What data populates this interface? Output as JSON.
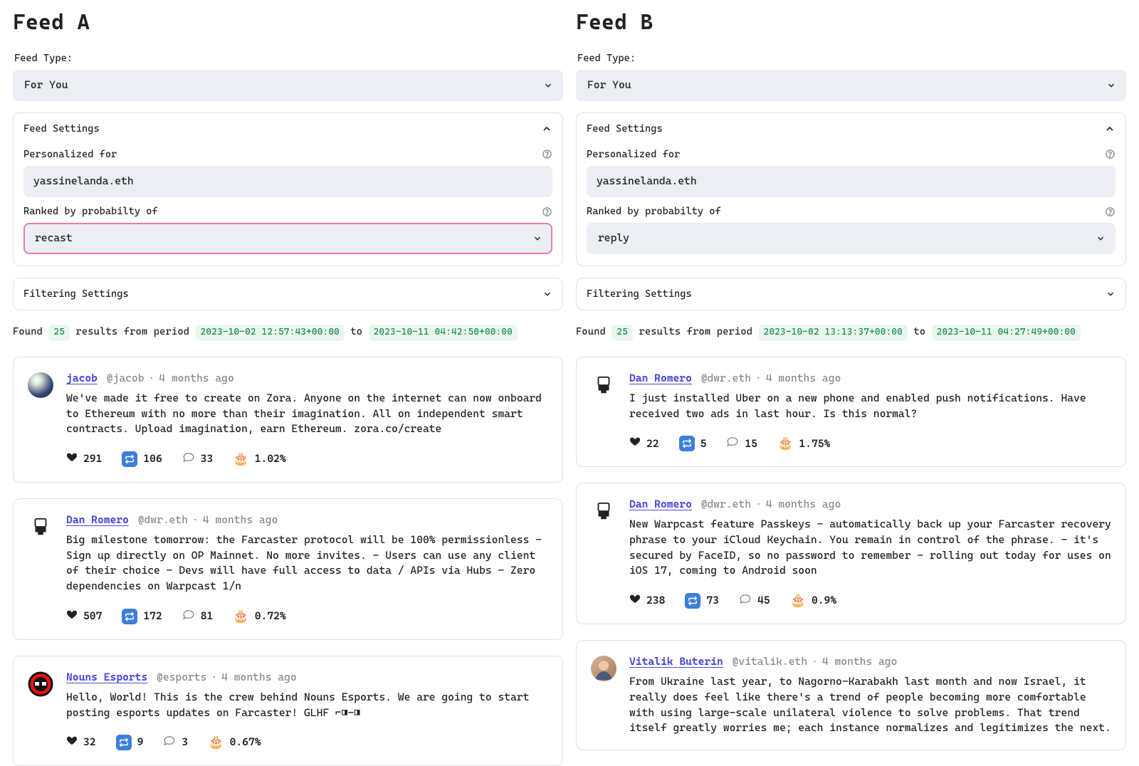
{
  "feeds": [
    {
      "title": "Feed A",
      "feed_type_label": "Feed Type:",
      "feed_type_value": "For You",
      "settings_header": "Feed Settings",
      "personalized_label": "Personalized for",
      "personalized_value": "yassinelanda.eth",
      "ranked_label": "Ranked by probabilty of",
      "ranked_value": "recast",
      "ranked_focused": true,
      "filtering_header": "Filtering Settings",
      "found_prefix": "Found",
      "found_count": "25",
      "found_mid": "results from period",
      "found_start": "2023-10-02 12:57:43+00:00",
      "found_to": "to",
      "found_end": "2023-10-11 04:42:50+00:00",
      "posts": [
        {
          "avatar_kind": "sphere",
          "author": "jacob",
          "handle": "@jacob",
          "time": "4 months ago",
          "content": "We've made it free to create on Zora. Anyone on the internet can now onboard to Ethereum with no more than their imagination. All on independent smart contracts. Upload imagination, earn Ethereum. zora.co/create",
          "likes": "291",
          "recasts": "106",
          "replies": "33",
          "prob": "1.02%"
        },
        {
          "avatar_kind": "dan",
          "author": "Dan Romero",
          "handle": "@dwr.eth",
          "time": "4 months ago",
          "content": "Big milestone tomorrow: the Farcaster protocol will be 100% permissionless - Sign up directly on OP Mainnet. No more invites. - Users can use any client of their choice - Devs will have full access to data / APIs via Hubs - Zero dependencies on Warpcast 1/n",
          "likes": "507",
          "recasts": "172",
          "replies": "81",
          "prob": "0.72%"
        },
        {
          "avatar_kind": "nouns",
          "author": "Nouns Esports",
          "handle": "@esports",
          "time": "4 months ago",
          "content": "Hello, World! This is the crew behind Nouns Esports. We are going to start posting esports updates on Farcaster! GLHF ⌐◨-◨",
          "likes": "32",
          "recasts": "9",
          "replies": "3",
          "prob": "0.67%"
        }
      ]
    },
    {
      "title": "Feed B",
      "feed_type_label": "Feed Type:",
      "feed_type_value": "For You",
      "settings_header": "Feed Settings",
      "personalized_label": "Personalized for",
      "personalized_value": "yassinelanda.eth",
      "ranked_label": "Ranked by probabilty of",
      "ranked_value": "reply",
      "ranked_focused": false,
      "filtering_header": "Filtering Settings",
      "found_prefix": "Found",
      "found_count": "25",
      "found_mid": "results from period",
      "found_start": "2023-10-02 13:13:37+00:00",
      "found_to": "to",
      "found_end": "2023-10-11 04:27:49+00:00",
      "posts": [
        {
          "avatar_kind": "dan",
          "author": "Dan Romero",
          "handle": "@dwr.eth",
          "time": "4 months ago",
          "content": "I just installed Uber on a new phone and enabled push notifications. Have received two ads in last hour. Is this normal?",
          "likes": "22",
          "recasts": "5",
          "replies": "15",
          "prob": "1.75%"
        },
        {
          "avatar_kind": "dan",
          "author": "Dan Romero",
          "handle": "@dwr.eth",
          "time": "4 months ago",
          "content": "New Warpcast feature Passkeys - automatically back up your Farcaster recovery phrase to your iCloud Keychain. You remain in control of the phrase. - it's secured by FaceID, so no password to remember - rolling out today for uses on iOS 17, coming to Android soon",
          "likes": "238",
          "recasts": "73",
          "replies": "45",
          "prob": "0.9%"
        },
        {
          "avatar_kind": "vitalik",
          "author": "Vitalik Buterin",
          "handle": "@vitalik.eth",
          "time": "4 months ago",
          "content": "From Ukraine last year, to Nagorno-Karabakh last month and now Israel, it really does feel like there's a trend of people becoming more comfortable with using large-scale unilateral violence to solve problems. That trend itself greatly worries me; each instance normalizes and legitimizes the next.",
          "likes": "",
          "recasts": "",
          "replies": "",
          "prob": ""
        }
      ]
    }
  ]
}
